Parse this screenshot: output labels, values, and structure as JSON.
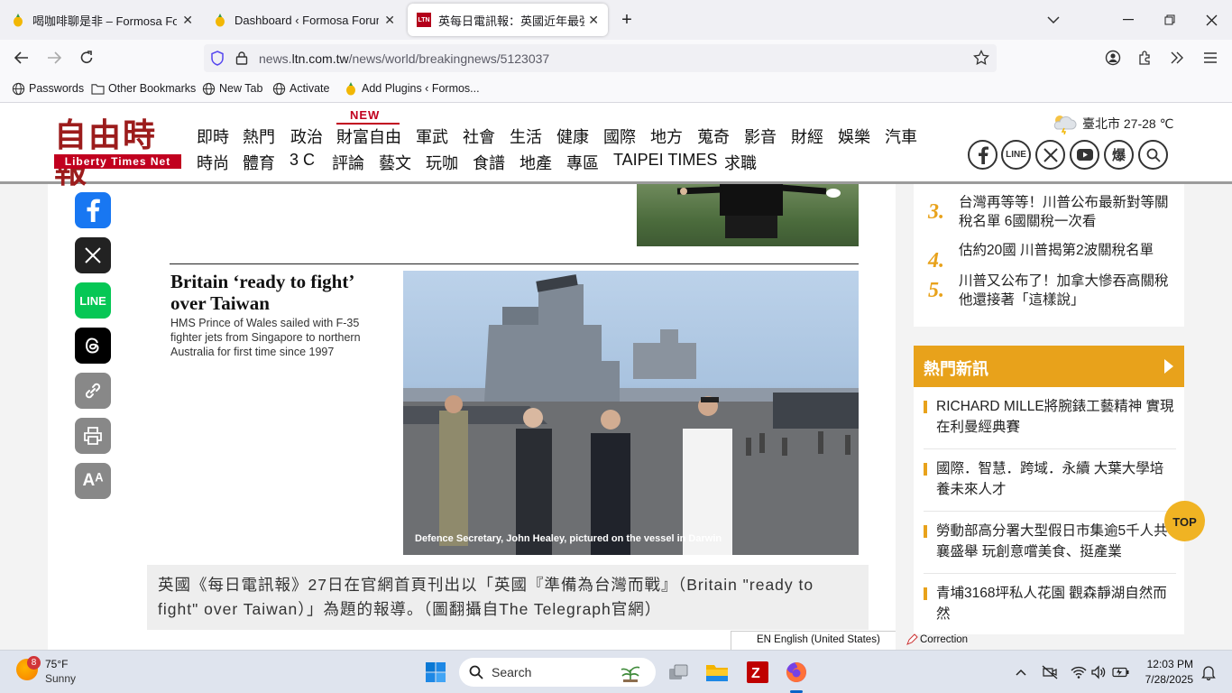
{
  "browser": {
    "tabs": [
      {
        "title": "喝咖啡聊是非 – Formosa Forum",
        "active": false
      },
      {
        "title": "Dashboard ‹ Formosa Forum —",
        "active": false
      },
      {
        "title": "英每日電訊報：英國近年最強硬",
        "active": true
      }
    ],
    "url_prefix": "news.",
    "url_domain": "ltn.com.tw",
    "url_path": "/news/world/breakingnews/5123037",
    "bookmarks": [
      "Passwords",
      "Other Bookmarks",
      "New Tab",
      "Activate",
      "Add Plugins ‹ Formos..."
    ]
  },
  "site": {
    "logo_text": "自由時報",
    "logo_sub": "Liberty Times Net",
    "new_badge": "NEW",
    "nav_row1": [
      "即時",
      "熱門",
      "政治",
      "財富自由",
      "軍武",
      "社會",
      "生活",
      "健康",
      "國際",
      "地方",
      "蒐奇",
      "影音",
      "財經",
      "娛樂",
      "汽車"
    ],
    "nav_row2": [
      "時尚",
      "體育",
      "3 C",
      "評論",
      "藝文",
      "玩咖",
      "食譜",
      "地產",
      "專區",
      "TAIPEI TIMES",
      "求職"
    ],
    "weather": "臺北市 27-28 ℃",
    "social_icons": [
      "facebook-icon",
      "line-icon",
      "x-icon",
      "youtube-icon",
      "bao-icon",
      "search-icon"
    ],
    "bao_label": "爆",
    "line_label": "LINE"
  },
  "article": {
    "share_buttons": [
      "facebook",
      "x",
      "line",
      "threads",
      "copy-link",
      "print",
      "font-size"
    ],
    "line_share_label": "LINE",
    "font_size_label": "Aᴬ",
    "headline": "Britain ‘ready to fight’ over Taiwan",
    "subhead": "HMS Prince of Wales sailed with F-35 fighter jets from Singapore to northern Australia for first time since 1997",
    "photo_caption": "Defence Secretary, John Healey, pictured on the vessel in Darwin",
    "caption": "英國《每日電訊報》27日在官網首頁刊出以「英國『準備為台灣而戰』（Britain \"ready to fight\" over Taiwan）」為題的報導。（圖翻攝自The Telegraph官網）"
  },
  "sidebar": {
    "ranking": [
      {
        "rank": "3.",
        "title": "台灣再等等！川普公布最新對等關稅名單 6國關稅一次看"
      },
      {
        "rank": "4.",
        "title": "估約20國 川普揭第2波關稅名單"
      },
      {
        "rank": "5.",
        "title": "川普又公布了！加拿大慘吞高關稅 他還接著「這樣說」"
      }
    ],
    "hot_title": "熱門新訊",
    "hot_items": [
      "RICHARD MILLE將腕錶工藝精神 實現在利曼經典賽",
      "國際．智慧．跨域．永續 大葉大學培養未來人才",
      "勞動部高分署大型假日市集逾5千人共襄盛舉 玩創意嚐美食、挺產業",
      "青埔3168坪私人花園 觀森靜湖自然而然"
    ],
    "top_button": "TOP"
  },
  "status": {
    "language": "EN English (United States)",
    "correction": "Correction"
  },
  "taskbar": {
    "weather_temp": "75°F",
    "weather_desc": "Sunny",
    "weather_badge": "8",
    "search_placeholder": "Search",
    "time": "12:03 PM",
    "date": "7/28/2025"
  }
}
